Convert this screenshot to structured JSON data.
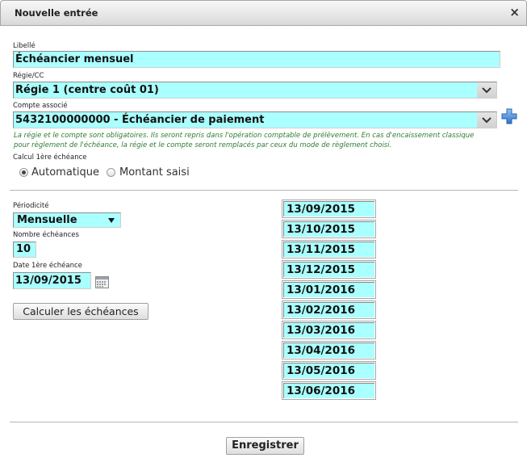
{
  "dialog": {
    "title": "Nouvelle entrée",
    "close_label": "×"
  },
  "form": {
    "libelle": {
      "label": "Libellé",
      "value": "Échéancier mensuel"
    },
    "regie": {
      "label": "Régie/CC",
      "value": "Régie 1 (centre coût 01)"
    },
    "compte": {
      "label": "Compte associé",
      "value": "5432100000000 - Échéancier de paiement"
    },
    "note": [
      "La régie et le compte sont obligatoires. Ils seront repris dans l'opération comptable de prélèvement. En cas d'encaissement classique",
      "pour règlement de l'échéance, la régie et le compte seront remplacés par ceux du mode de règlement choisi."
    ],
    "calcul": {
      "label": "Calcul 1ère échéance",
      "options": [
        {
          "label": "Automatique",
          "checked": true
        },
        {
          "label": "Montant saisi",
          "checked": false
        }
      ]
    },
    "periodicite": {
      "label": "Périodicité",
      "value": "Mensuelle"
    },
    "nombre_echeances": {
      "label": "Nombre échéances",
      "value": "10"
    },
    "date_premiere": {
      "label": "Date 1ère échéance",
      "value": "13/09/2015"
    },
    "calculer_label": "Calculer les échéances",
    "echeances": [
      "13/09/2015",
      "13/10/2015",
      "13/11/2015",
      "13/12/2015",
      "13/01/2016",
      "13/02/2016",
      "13/03/2016",
      "13/04/2016",
      "13/05/2016",
      "13/06/2016"
    ]
  },
  "footer": {
    "save_label": "Enregistrer"
  },
  "icons": {
    "close": "close-icon",
    "regie_dropdown": "chevron-down-icon",
    "compte_dropdown": "chevron-down-icon",
    "add_compte": "plus-icon",
    "periodicite_dropdown": "triangle-down-icon",
    "date_picker": "calendar-icon"
  },
  "colors": {
    "field_background": "#aaffff",
    "note_text": "#2e7d32",
    "plus_icon": "#3f86d9"
  }
}
